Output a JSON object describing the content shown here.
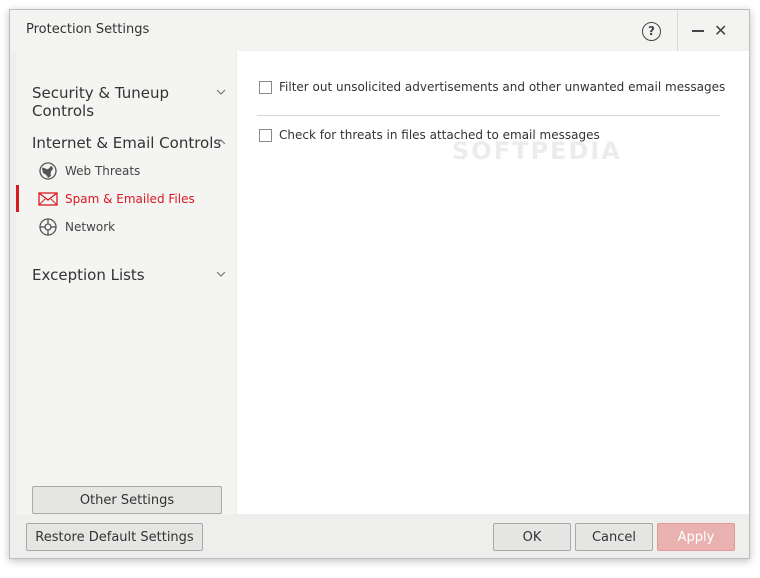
{
  "window": {
    "title": "Protection Settings"
  },
  "titlebar": {
    "help_symbol": "?",
    "minimize_symbol": "—",
    "close_symbol": "✕"
  },
  "sidebar": {
    "sections": [
      {
        "label_line1": "Security & Tuneup",
        "label_line2": "Controls",
        "expanded": false
      },
      {
        "label": "Internet & Email Controls",
        "expanded": true,
        "items": [
          {
            "label": "Web Threats",
            "icon": "globe-icon"
          },
          {
            "label": "Spam & Emailed Files",
            "icon": "envelope-icon",
            "active": true
          },
          {
            "label": "Network",
            "icon": "network-icon"
          }
        ]
      },
      {
        "label": "Exception Lists",
        "expanded": false
      }
    ],
    "other_settings_label": "Other Settings"
  },
  "main": {
    "watermark": "SOFTPEDIA",
    "options": [
      {
        "label": "Filter out unsolicited advertisements and other unwanted email messages",
        "checked": false
      },
      {
        "label": "Check for threats in files attached to email messages",
        "checked": false
      }
    ]
  },
  "footer": {
    "restore_label": "Restore Default Settings",
    "ok_label": "OK",
    "cancel_label": "Cancel",
    "apply_label": "Apply"
  },
  "colors": {
    "accent": "#d71a20",
    "apply_disabled": "#eab1b1"
  }
}
